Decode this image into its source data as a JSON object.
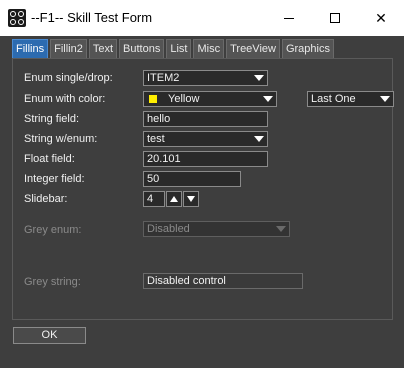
{
  "window": {
    "title": "--F1-- Skill Test Form",
    "minimize_glyph": "minimize-icon",
    "maximize_glyph": "maximize-icon",
    "close_glyph": "✕"
  },
  "tabs": [
    {
      "label": "Fillins",
      "active": true
    },
    {
      "label": "Fillin2",
      "active": false
    },
    {
      "label": "Text",
      "active": false
    },
    {
      "label": "Buttons",
      "active": false
    },
    {
      "label": "List",
      "active": false
    },
    {
      "label": "Misc",
      "active": false
    },
    {
      "label": "TreeView",
      "active": false
    },
    {
      "label": "Graphics",
      "active": false
    }
  ],
  "form": {
    "enum_single_drop": {
      "label": "Enum single/drop:",
      "value": "ITEM2"
    },
    "enum_with_color": {
      "label": "Enum with color:",
      "value": "Yellow",
      "color": "#ffee00",
      "second_value": "Last One"
    },
    "string_field": {
      "label": "String field:",
      "value": "hello"
    },
    "string_w_enum": {
      "label": "String w/enum:",
      "value": "test"
    },
    "float_field": {
      "label": "Float field:",
      "value": "20.101"
    },
    "integer_field": {
      "label": "Integer field:",
      "value": "50"
    },
    "slidebar": {
      "label": "Slidebar:",
      "value": "4"
    },
    "grey_enum": {
      "label": "Grey enum:",
      "value": "Disabled"
    },
    "grey_string": {
      "label": "Grey string:",
      "value": "Disabled control"
    }
  },
  "footer": {
    "ok_label": "OK"
  },
  "colors": {
    "accent_tab": "#2c6bb0",
    "background": "#3e3e3e"
  }
}
